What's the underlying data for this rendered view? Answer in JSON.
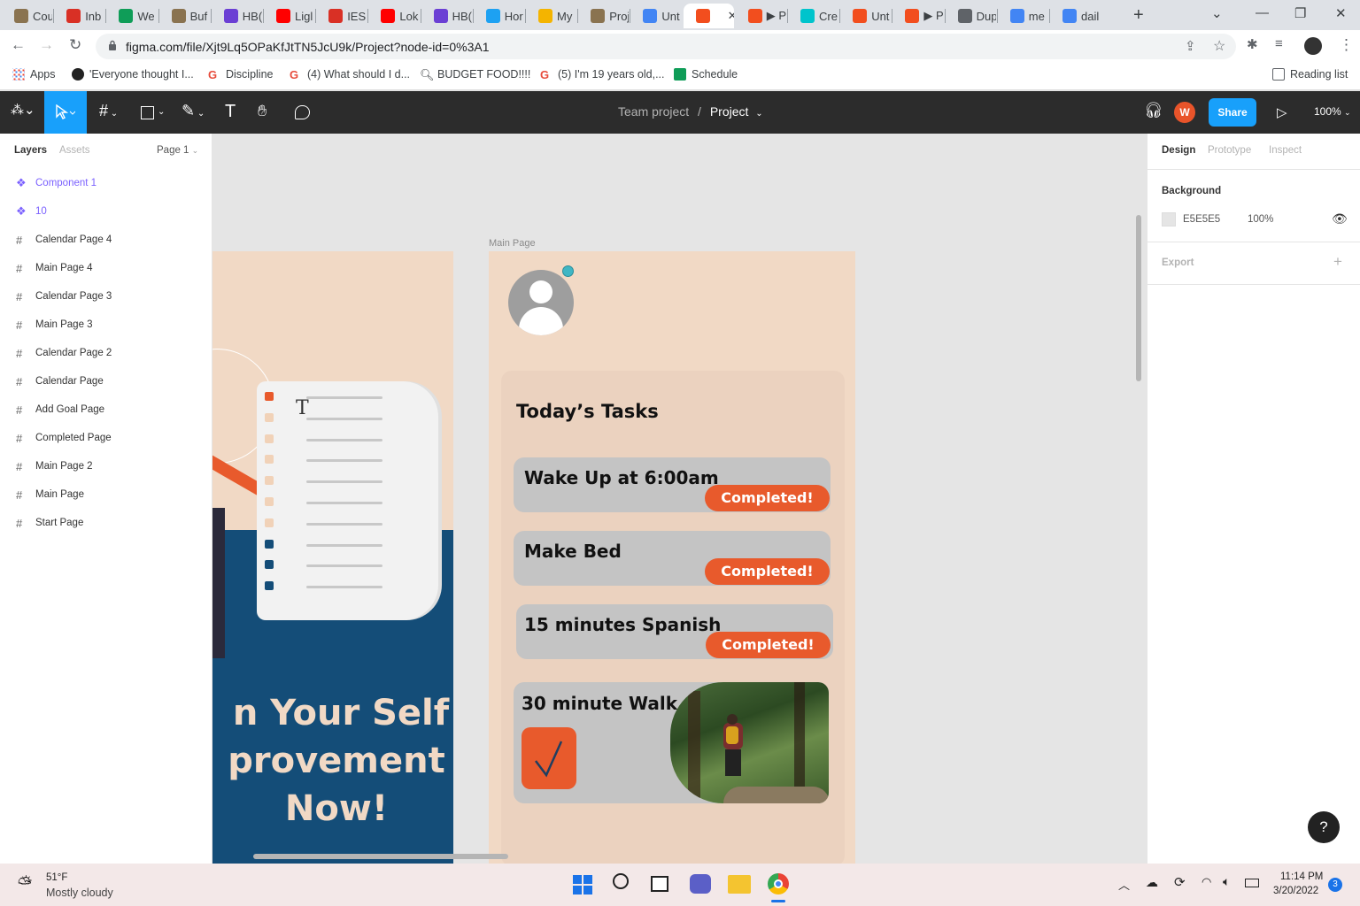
{
  "browser": {
    "tabs": [
      {
        "label": "Cou",
        "icon": "cu-icon",
        "color": "#8a7350"
      },
      {
        "label": "Inb",
        "icon": "gmail-icon",
        "color": "#d93025"
      },
      {
        "label": "We",
        "icon": "sheets-icon",
        "color": "#0f9d58"
      },
      {
        "label": "Buf",
        "icon": "cu-icon",
        "color": "#8a7350"
      },
      {
        "label": "HB(",
        "icon": "m-icon",
        "color": "#6b3fd4"
      },
      {
        "label": "Ligl",
        "icon": "youtube-icon",
        "color": "#ff0000"
      },
      {
        "label": "IES",
        "icon": "gmail-icon",
        "color": "#d93025"
      },
      {
        "label": "Lok",
        "icon": "youtube-icon",
        "color": "#ff0000"
      },
      {
        "label": "HB(",
        "icon": "m-icon",
        "color": "#6b3fd4"
      },
      {
        "label": "Hor",
        "icon": "twitter-icon",
        "color": "#1da1f2"
      },
      {
        "label": "My",
        "icon": "drive-icon",
        "color": "#f4b400"
      },
      {
        "label": "Proj",
        "icon": "cu-icon",
        "color": "#8a7350"
      },
      {
        "label": "Unt",
        "icon": "docs-icon",
        "color": "#4285f4"
      },
      {
        "label": "",
        "icon": "figma-icon",
        "color": "#f24e1e",
        "active": true
      },
      {
        "label": "▶ P",
        "icon": "figma-icon",
        "color": "#f24e1e"
      },
      {
        "label": "Cre",
        "icon": "canva-icon",
        "color": "#00c4cc"
      },
      {
        "label": "Unt",
        "icon": "figma-icon",
        "color": "#f24e1e"
      },
      {
        "label": "▶ P",
        "icon": "figma-icon",
        "color": "#f24e1e"
      },
      {
        "label": "Dup",
        "icon": "globe-icon",
        "color": "#5f6368"
      },
      {
        "label": "me",
        "icon": "google-icon",
        "color": "#4285f4"
      },
      {
        "label": "dail",
        "icon": "google-icon",
        "color": "#4285f4"
      }
    ],
    "url": "figma.com/file/Xjt9Lq5OPaKfJtTN5JcU9k/Project?node-id=0%3A1",
    "bookmarks": [
      {
        "label": "Apps",
        "icon": "apps-grid-icon"
      },
      {
        "label": "'Everyone thought I...",
        "icon": "bookmark-site-icon"
      },
      {
        "label": "Discipline",
        "icon": "reddit-icon"
      },
      {
        "label": "(4) What should I d...",
        "icon": "reddit-icon"
      },
      {
        "label": "BUDGET FOOD!!!!",
        "icon": "search-bookmark-icon"
      },
      {
        "label": "(5) I'm 19 years old,...",
        "icon": "reddit-icon"
      },
      {
        "label": "Schedule",
        "icon": "sheets-icon"
      }
    ],
    "reading_list": "Reading list"
  },
  "figma": {
    "breadcrumb_team": "Team project",
    "breadcrumb_sep": "/",
    "breadcrumb_project": "Project",
    "user_initial": "W",
    "share_label": "Share",
    "zoom": "100%",
    "left_tabs": {
      "layers": "Layers",
      "assets": "Assets",
      "page": "Page 1"
    },
    "layers": [
      {
        "label": "Component 1",
        "type": "component"
      },
      {
        "label": "10",
        "type": "component"
      },
      {
        "label": "Calendar Page 4",
        "type": "frame"
      },
      {
        "label": "Main Page 4",
        "type": "frame"
      },
      {
        "label": "Calendar Page 3",
        "type": "frame"
      },
      {
        "label": "Main Page 3",
        "type": "frame"
      },
      {
        "label": "Calendar Page 2",
        "type": "frame"
      },
      {
        "label": "Calendar Page",
        "type": "frame"
      },
      {
        "label": "Add Goal Page",
        "type": "frame"
      },
      {
        "label": "Completed Page",
        "type": "frame"
      },
      {
        "label": "Main Page 2",
        "type": "frame"
      },
      {
        "label": "Main Page",
        "type": "frame"
      },
      {
        "label": "Start Page",
        "type": "frame"
      }
    ],
    "right_tabs": {
      "design": "Design",
      "prototype": "Prototype",
      "inspect": "Inspect"
    },
    "background_label": "Background",
    "background_hex": "E5E5E5",
    "background_opacity": "100%",
    "export_label": "Export",
    "help": "?"
  },
  "canvas": {
    "frame_label": "Main Page",
    "start_page_text": [
      "n Your Self",
      "provement",
      "Now!"
    ],
    "tasks_title": "Today’s Tasks",
    "tasks": [
      {
        "title": "Wake Up at 6:00am",
        "status": "Completed!"
      },
      {
        "title": "Make Bed",
        "status": "Completed!"
      },
      {
        "title": "15 minutes Spanish",
        "status": "Completed!"
      },
      {
        "title": "30 minute Walk",
        "status": "checked"
      }
    ],
    "colors": {
      "accent": "#e85a2c",
      "frame_bg": "#f1d9c5",
      "card_bg": "#c4c4c4",
      "navy": "#144d78"
    }
  },
  "taskbar": {
    "temp": "51°F",
    "weather": "Mostly cloudy",
    "time": "11:14 PM",
    "date": "3/20/2022",
    "notifications": "3"
  }
}
